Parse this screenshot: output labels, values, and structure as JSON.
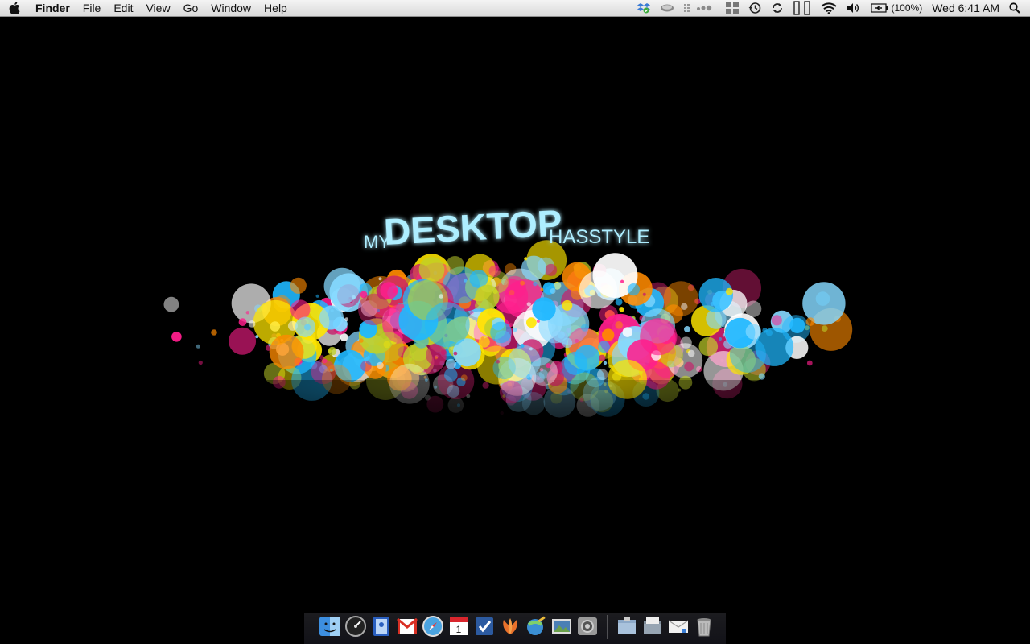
{
  "menubar": {
    "app_name": "Finder",
    "menus": [
      "File",
      "Edit",
      "View",
      "Go",
      "Window",
      "Help"
    ],
    "battery_text": "(100%)",
    "clock": "Wed 6:41 AM"
  },
  "wallpaper": {
    "title_small_left": "MY",
    "title_main": "DESKTOP",
    "title_small_right": "HASSTYLE"
  },
  "dock": {
    "apps": [
      "finder",
      "dashboard",
      "address-book",
      "gmail",
      "safari",
      "ical",
      "omnifocus",
      "growl",
      "iphoto-mail",
      "iphoto",
      "system-preferences"
    ],
    "stacks": [
      "applications-stack",
      "documents-stack",
      "mail-stack",
      "trash"
    ]
  }
}
